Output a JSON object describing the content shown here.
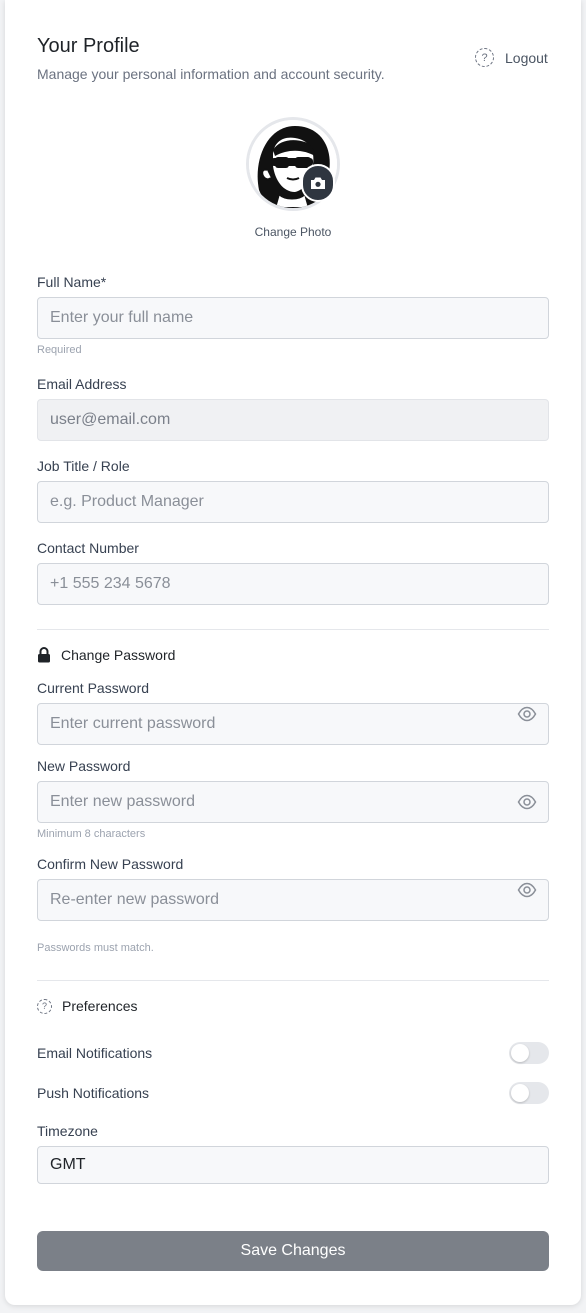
{
  "header": {
    "title": "Your Profile",
    "subtitle": "Manage your personal information and account security.",
    "logout_label": "Logout",
    "help_glyph": "?"
  },
  "avatar": {
    "change_photo_label": "Change Photo"
  },
  "profile": {
    "full_name": {
      "label": "Full Name",
      "required_mark": "*",
      "placeholder": "Enter your full name",
      "hint": "Required"
    },
    "email": {
      "label": "Email Address",
      "value": "user@email.com"
    },
    "job_title": {
      "label": "Job Title / Role",
      "placeholder": "e.g. Product Manager"
    },
    "contact": {
      "label": "Contact Number",
      "placeholder": "+1 555 234 5678"
    }
  },
  "password": {
    "section_title": "Change Password",
    "current": {
      "label": "Current Password",
      "placeholder": "Enter current password"
    },
    "new": {
      "label": "New Password",
      "placeholder": "Enter new password",
      "hint": "Minimum 8 characters"
    },
    "confirm": {
      "label": "Confirm New Password",
      "placeholder": "Re-enter new password"
    },
    "match_hint": "Passwords must match."
  },
  "preferences": {
    "section_title": "Preferences",
    "help_glyph": "?",
    "email_notifications": {
      "label": "Email Notifications",
      "enabled": false
    },
    "push_notifications": {
      "label": "Push Notifications",
      "enabled": false
    },
    "timezone": {
      "label": "Timezone",
      "value": "GMT"
    }
  },
  "actions": {
    "save_label": "Save Changes"
  },
  "colors": {
    "save_button": "#7b8088",
    "input_bg": "#f7f8fa",
    "toggle_off": "#e5e7eb"
  },
  "icons": {
    "logout": "help-circle-icon",
    "camera": "camera-icon",
    "lock": "lock-icon",
    "eye": "eye-icon",
    "preferences": "help-circle-icon"
  }
}
